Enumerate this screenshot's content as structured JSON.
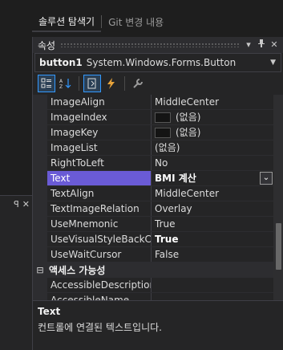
{
  "top_tabs": [
    {
      "label": "솔루션 탐색기",
      "active": true
    },
    {
      "label": "Git 변경 내용",
      "active": false
    }
  ],
  "properties": {
    "title": "속성",
    "object": {
      "name": "button1",
      "type": "System.Windows.Forms.Button"
    },
    "rows": [
      {
        "name": "ImageAlign",
        "value": "MiddleCenter"
      },
      {
        "name": "ImageIndex",
        "value": "(없음)",
        "swatch": true
      },
      {
        "name": "ImageKey",
        "value": "(없음)",
        "swatch": true
      },
      {
        "name": "ImageList",
        "value": "(없음)"
      },
      {
        "name": "RightToLeft",
        "value": "No"
      },
      {
        "name": "Text",
        "value": "BMI 계산",
        "selected": true
      },
      {
        "name": "TextAlign",
        "value": "MiddleCenter"
      },
      {
        "name": "TextImageRelation",
        "value": "Overlay"
      },
      {
        "name": "UseMnemonic",
        "value": "True"
      },
      {
        "name": "UseVisualStyleBackColor",
        "value": "True",
        "bold": true
      },
      {
        "name": "UseWaitCursor",
        "value": "False"
      }
    ],
    "category": {
      "toggle": "⊟",
      "label": "액세스 가능성"
    },
    "rows_after": [
      {
        "name": "AccessibleDescription",
        "value": ""
      },
      {
        "name": "AccessibleName",
        "value": ""
      }
    ],
    "description": {
      "title": "Text",
      "text": "컨트롤에 연결된 텍스트입니다."
    }
  },
  "colors": {
    "selection": "#6a5bd6",
    "accent": "#3399ff"
  }
}
